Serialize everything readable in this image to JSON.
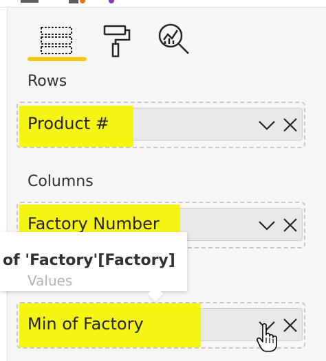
{
  "tabs": [
    {
      "name": "fields-tab",
      "icon": "table-fields-icon",
      "selected": true
    },
    {
      "name": "format-tab",
      "icon": "paint-roller-icon",
      "selected": false
    },
    {
      "name": "analytics-tab",
      "icon": "analytics-magnifier-icon",
      "selected": false
    }
  ],
  "sections": {
    "rows": {
      "label": "Rows",
      "field": "Product #"
    },
    "columns": {
      "label": "Columns",
      "field": "Factory Number"
    },
    "values": {
      "label": "Values",
      "field": "Min of Factory"
    }
  },
  "tooltip": {
    "text": "of 'Factory'[Factory]"
  },
  "colors": {
    "accent": "#f2c811",
    "highlight": "#f5f500",
    "field_bg": "#e9e9e9",
    "pane_bg": "#f6f6f6"
  }
}
